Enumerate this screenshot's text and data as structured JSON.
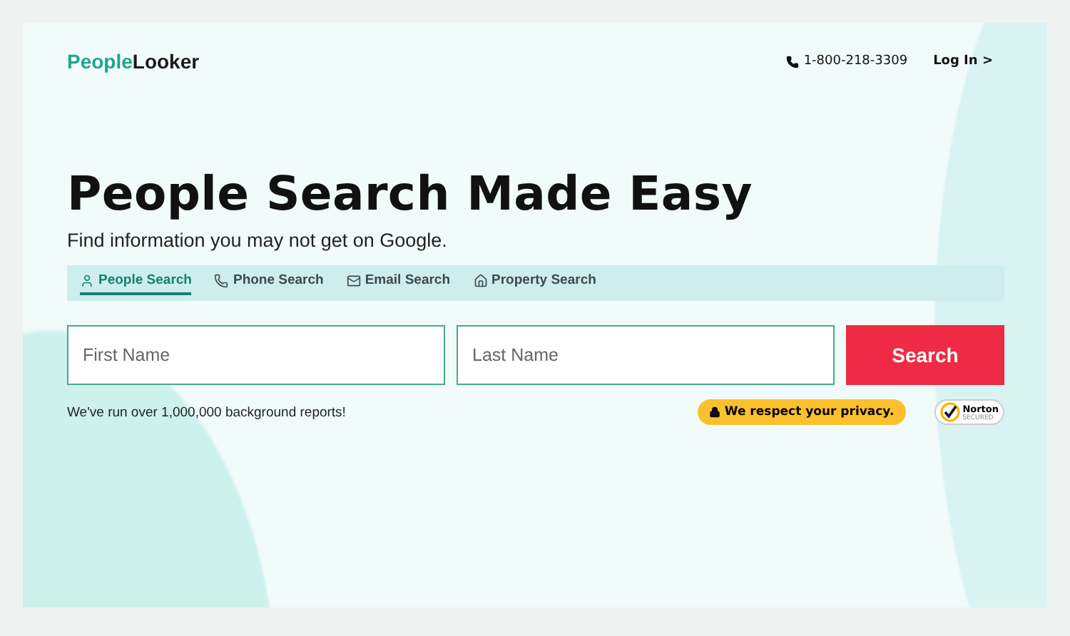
{
  "header": {
    "logo": {
      "part_1": "People",
      "part_2": "Looker"
    },
    "phone": "1-800-218-3309",
    "login": "Log In >"
  },
  "hero": {
    "title": "People Search Made Easy",
    "subtitle": "Find information you may not get on Google."
  },
  "tabs": [
    {
      "label": "People Search",
      "kind": "person",
      "selected": true
    },
    {
      "label": "Phone Search",
      "kind": "phone",
      "selected": false
    },
    {
      "label": "Email Search",
      "kind": "email",
      "selected": false
    },
    {
      "label": "Property Search",
      "kind": "property",
      "selected": false
    }
  ],
  "form": {
    "fields": [
      {
        "placeholder": "First Name"
      },
      {
        "placeholder": "Last Name"
      }
    ],
    "button": "Search"
  },
  "footer": {
    "reports": "We've run over 1,000,000 background reports!",
    "privacy": "We respect your privacy.",
    "norton": {
      "name": "Norton",
      "tag": "SECURED"
    }
  }
}
